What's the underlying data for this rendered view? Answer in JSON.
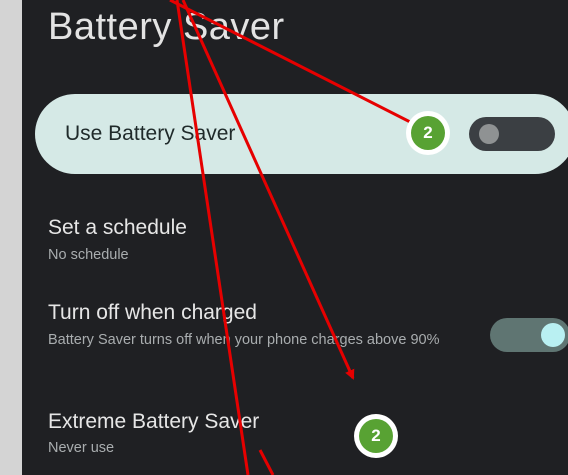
{
  "header": {
    "title": "Battery Saver"
  },
  "main_toggle": {
    "label": "Use Battery Saver",
    "state": "off"
  },
  "schedule": {
    "title": "Set a schedule",
    "subtitle": "No schedule"
  },
  "turn_off_charged": {
    "title": "Turn off when charged",
    "subtitle": "Battery Saver turns off when your phone charges above 90%",
    "state": "on"
  },
  "extreme": {
    "title": "Extreme Battery Saver",
    "subtitle": "Never use"
  },
  "annotations": {
    "badge_1": "2",
    "badge_2": "2"
  },
  "colors": {
    "arrow": "#e60000",
    "badge": "#58a233",
    "card": "#d5e9e6",
    "background": "#1f2023"
  }
}
